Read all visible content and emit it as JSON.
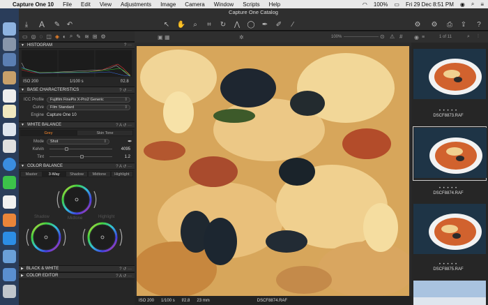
{
  "menubar": {
    "apple": "",
    "app": "Capture One 10",
    "items": [
      "File",
      "Edit",
      "View",
      "Adjustments",
      "Image",
      "Camera",
      "Window",
      "Scripts",
      "Help"
    ],
    "battery": "100%",
    "datetime": "Fri 29 Dec  8:51 PM"
  },
  "window": {
    "title": "Capture One Catalog"
  },
  "toolbar": {
    "zoom": "100%",
    "count": "1 of 11"
  },
  "histogram": {
    "title": "HISTOGRAM",
    "iso": "ISO 200",
    "shutter": "1/100 s",
    "aperture": "f/2.8"
  },
  "base": {
    "title": "BASE CHARACTERISTICS",
    "icc_label": "ICC Profile",
    "icc": "Fujifilm FinePix X-Pro2 Generic",
    "curve_label": "Curve",
    "curve": "Film Standard",
    "engine_label": "Engine",
    "engine": "Capture One 10"
  },
  "wb": {
    "title": "WHITE BALANCE",
    "tabs": [
      "Grey",
      "Skin Tone"
    ],
    "mode_label": "Mode",
    "mode": "Shot",
    "kelvin_label": "Kelvin",
    "kelvin": "4095",
    "tint_label": "Tint",
    "tint": "1.2"
  },
  "cb": {
    "title": "COLOR BALANCE",
    "tabs": [
      "Master",
      "3-Way",
      "Shadow",
      "Midtone",
      "Highlight"
    ],
    "shadow": "Shadow",
    "midtone": "Midtone",
    "highlight": "Highlight"
  },
  "bw": {
    "title": "BLACK & WHITE"
  },
  "ce": {
    "title": "COLOR EDITOR"
  },
  "viewer": {
    "iso": "ISO 200",
    "shutter": "1/100 s",
    "aperture": "f/2.8",
    "focal": "23 mm",
    "filename": "DSCF8874.RAF"
  },
  "browser": {
    "thumbs": [
      "DSCF8873.RAF",
      "DSCF8874.RAF",
      "DSCF8875.RAF"
    ]
  }
}
